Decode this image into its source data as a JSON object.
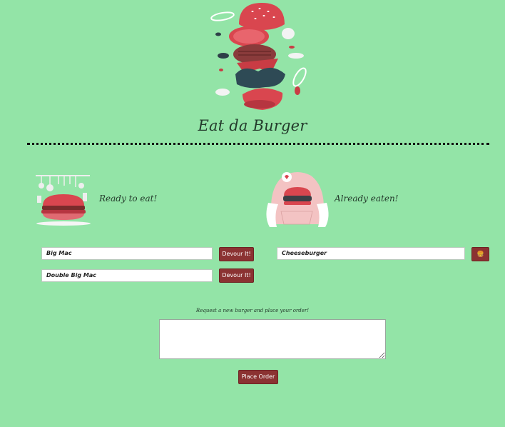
{
  "header": {
    "title": "Eat da Burger",
    "hero_icon": "exploded-burger-icon"
  },
  "ready": {
    "label": "Ready to eat!",
    "icon": "kitchen-burger-icon",
    "items": [
      {
        "name": "Big Mac",
        "button_label": "Devour It!"
      },
      {
        "name": "Double Big Mac",
        "button_label": "Devour It!"
      }
    ]
  },
  "eaten": {
    "label": "Already eaten!",
    "icon": "person-eating-burger-icon",
    "items": [
      {
        "name": "Cheeseburger",
        "button_icon": "burger-emoji-icon",
        "button_glyph": "🍔"
      }
    ]
  },
  "order": {
    "prompt": "Request a new burger and place your order!",
    "input_value": "",
    "submit_label": "Place Order"
  },
  "colors": {
    "background": "#93e4a7",
    "accent": "#8b3232",
    "burger_red": "#d9464f"
  }
}
